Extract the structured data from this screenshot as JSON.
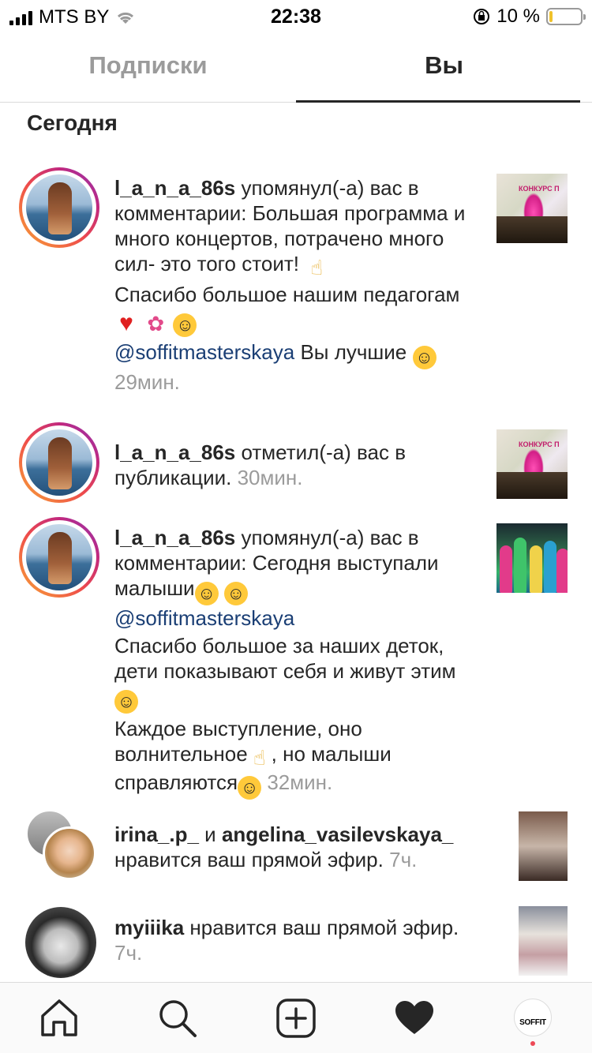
{
  "status_bar": {
    "carrier": "MTS BY",
    "time": "22:38",
    "battery_percent": "10 %",
    "battery_level": 0.1
  },
  "tabs": {
    "following": "Подписки",
    "you": "Вы"
  },
  "section_title": "Сегодня",
  "notifications": [
    {
      "username": "l_a_n_a_86s",
      "action": "упомянул(-а) вас в комментарии: Большая программа и много концертов, потрачено много сил- это того стоит!",
      "line2": "Спасибо большое нашим педагогам",
      "mention": "@soffitmasterskaya",
      "line3": "Вы лучшие",
      "time": "29мин."
    },
    {
      "username": "l_a_n_a_86s",
      "action": "отметил(-а) вас в публикации.",
      "time": "30мин."
    },
    {
      "username": "l_a_n_a_86s",
      "action": "упомянул(-а) вас в комментарии: Сегодня выступали малыши",
      "mention": "@soffitmasterskaya",
      "line2": "Спасибо большое за наших деток, дети показывают себя и живут этим",
      "line3": "Каждое выступление, оно волнительное",
      "line3b": ", но малыши справляются",
      "time": "32мин."
    },
    {
      "username": "irina_.p_",
      "joiner": "и",
      "username2": "angelina_vasilevskaya_",
      "action": "нравится ваш прямой эфир.",
      "time": "7ч."
    },
    {
      "username": "myiiika",
      "action": "нравится ваш прямой эфир.",
      "time": "7ч."
    }
  ],
  "thumb_text": "КОНКУРС П",
  "nav": {
    "profile_label": "SOFFIT"
  },
  "colors": {
    "mention": "#1b3f75",
    "time": "#9b9b9b",
    "notification_dot": "#ed4956"
  }
}
